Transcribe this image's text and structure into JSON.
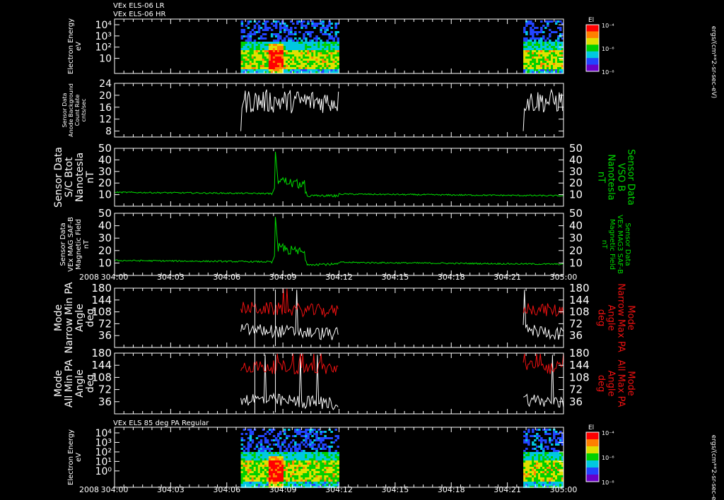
{
  "colors": {
    "background": "#000000",
    "white": "#ffffff",
    "green": "#00dd00",
    "red": "#ee1111"
  },
  "header": {
    "line1": "VEx ELS-06 LR",
    "line2": "VEx ELS-06 HR"
  },
  "subheader": "VEx ELS 85 deg PA Regular",
  "year_label": "2008",
  "time_ticks": [
    "304:00",
    "304:03",
    "304:06",
    "304:09",
    "304:12",
    "304:15",
    "304:18",
    "304:21",
    "305:00"
  ],
  "colorbar": {
    "title": "El",
    "labels": [
      "10⁻⁴",
      "10⁻⁶",
      "10⁻⁸"
    ],
    "units": "ergs/(cm**2-sr-sec-eV)"
  },
  "chart_data": [
    {
      "type": "heatmap",
      "id": "energy1",
      "ylabel": [
        "Electron Energy",
        "eV"
      ],
      "yticks": [
        "10⁴",
        "10³",
        "10²",
        "10"
      ],
      "x_range_minutes": [
        0,
        480
      ],
      "data_intervals_minutes": [
        [
          135,
          240
        ],
        [
          437,
          480
        ]
      ]
    },
    {
      "type": "line",
      "id": "bkg",
      "ylabel": [
        "Sensor Data",
        "Anode Background",
        "Count Rate",
        "cnts/sec"
      ],
      "yticks": [
        8,
        12,
        16,
        20,
        24
      ],
      "ylim": [
        6,
        24
      ],
      "series": [
        {
          "color": "white",
          "gaps": [
            [
              240,
              437
            ]
          ],
          "range": [
            12,
            22
          ]
        }
      ]
    },
    {
      "type": "line",
      "id": "bmag1",
      "ylabel": [
        "Sensor Data",
        "S/C Btot",
        "Nanotesla",
        "nT"
      ],
      "rlabel": [
        "Sensor Data",
        "VSO B",
        "Nanotesla",
        "nT"
      ],
      "yticks": [
        10,
        20,
        30,
        40,
        50
      ],
      "ylim": [
        0,
        50
      ],
      "series": [
        {
          "color": "green",
          "baseline": [
            12,
            9
          ],
          "peak": {
            "x": 172,
            "y": 47
          }
        }
      ]
    },
    {
      "type": "line",
      "id": "bmag2",
      "ylabel": [
        "Sensor Data",
        "VEx MAG SAF-B",
        "Magnetic Field",
        "nT"
      ],
      "rlabel": [
        "Sensor Data",
        "VEx MAG3 SAF-B",
        "Magnetic Field",
        "nT"
      ],
      "yticks": [
        10,
        20,
        30,
        40,
        50
      ],
      "ylim": [
        0,
        50
      ],
      "series": [
        {
          "color": "green",
          "baseline": [
            12,
            9
          ],
          "peak": {
            "x": 172,
            "y": 47
          }
        }
      ]
    },
    {
      "type": "line",
      "id": "pa_narrow",
      "ylabel": [
        "Mode",
        "Narrow Min PA",
        "Angle",
        "deg"
      ],
      "rlabel": [
        "Mode",
        "Narrow Max PA",
        "Angle",
        "deg"
      ],
      "yticks": [
        36,
        72,
        108,
        144,
        180
      ],
      "ylim": [
        0,
        180
      ],
      "series": [
        {
          "name": "Min PA",
          "color": "white",
          "level": [
            55,
            40
          ]
        },
        {
          "name": "Max PA",
          "color": "red",
          "level": [
            120,
            110
          ]
        }
      ]
    },
    {
      "type": "line",
      "id": "pa_all",
      "ylabel": [
        "Mode",
        "All Min PA",
        "Angle",
        "deg"
      ],
      "rlabel": [
        "Mode",
        "All Max PA",
        "Angle",
        "deg"
      ],
      "yticks": [
        36,
        72,
        108,
        144,
        180
      ],
      "ylim": [
        0,
        180
      ],
      "series": [
        {
          "name": "Min PA",
          "color": "white",
          "level": [
            45,
            30
          ]
        },
        {
          "name": "Max PA",
          "color": "red",
          "level": [
            140,
            135
          ]
        }
      ]
    },
    {
      "type": "heatmap",
      "id": "energy2",
      "ylabel": [
        "Electron Energy",
        "eV"
      ],
      "yticks": [
        "10⁴",
        "10³",
        "10²",
        "10¹",
        "10⁰"
      ],
      "x_range_minutes": [
        0,
        480
      ],
      "data_intervals_minutes": [
        [
          135,
          240
        ],
        [
          437,
          480
        ]
      ]
    }
  ]
}
